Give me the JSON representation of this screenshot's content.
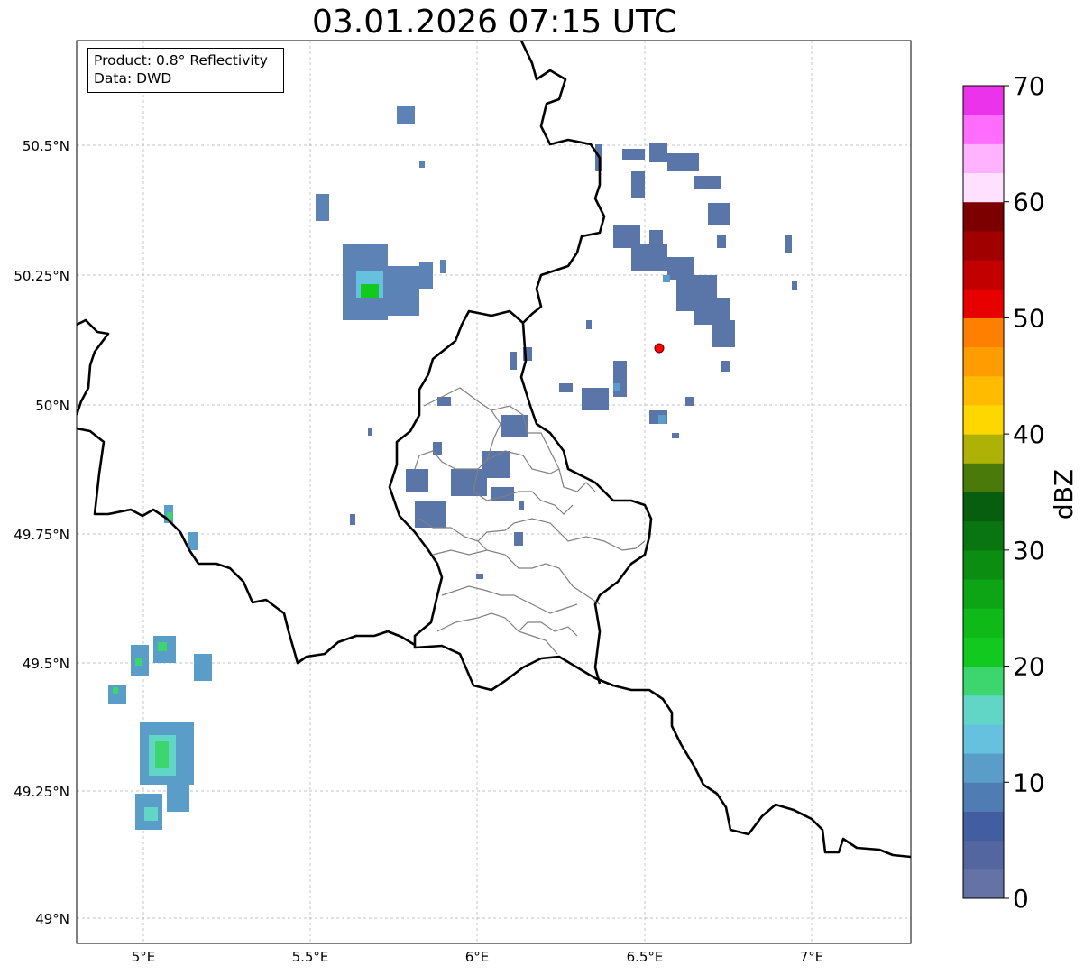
{
  "title": "03.01.2026 07:15 UTC",
  "info": {
    "product": "Product: 0.8° Reflectivity",
    "source": "Data: DWD"
  },
  "map": {
    "lon_range": [
      4.8,
      7.3
    ],
    "lat_range": [
      48.95,
      50.7
    ],
    "gridlines": true,
    "x_ticks": [
      "5°E",
      "5.5°E",
      "6°E",
      "6.5°E",
      "7°E"
    ],
    "y_ticks": [
      "49°N",
      "49.25°N",
      "49.5°N",
      "49.75°N",
      "50°N",
      "50.25°N",
      "50.5°N"
    ],
    "radar_site_marker": {
      "lon": 6.55,
      "lat": 50.11,
      "color": "#ff0000"
    }
  },
  "colorbar": {
    "label": "dBZ",
    "ticks": [
      "0",
      "10",
      "20",
      "30",
      "40",
      "50",
      "60",
      "70"
    ],
    "range": [
      0,
      70
    ],
    "colors": [
      "#6572a6",
      "#5366a0",
      "#425ea0",
      "#4f7db3",
      "#5a9dc8",
      "#65c1dd",
      "#62d6c6",
      "#3dd56e",
      "#12c920",
      "#0fba18",
      "#0da415",
      "#0b8d12",
      "#087510",
      "#065e0e",
      "#497a0a",
      "#aeb106",
      "#ffd700",
      "#ffbb00",
      "#ff9d00",
      "#ff7f00",
      "#e60000",
      "#c20000",
      "#a00000",
      "#7c0000",
      "#ffe1ff",
      "#ffb3ff",
      "#ff6dff",
      "#ec33ec"
    ]
  }
}
